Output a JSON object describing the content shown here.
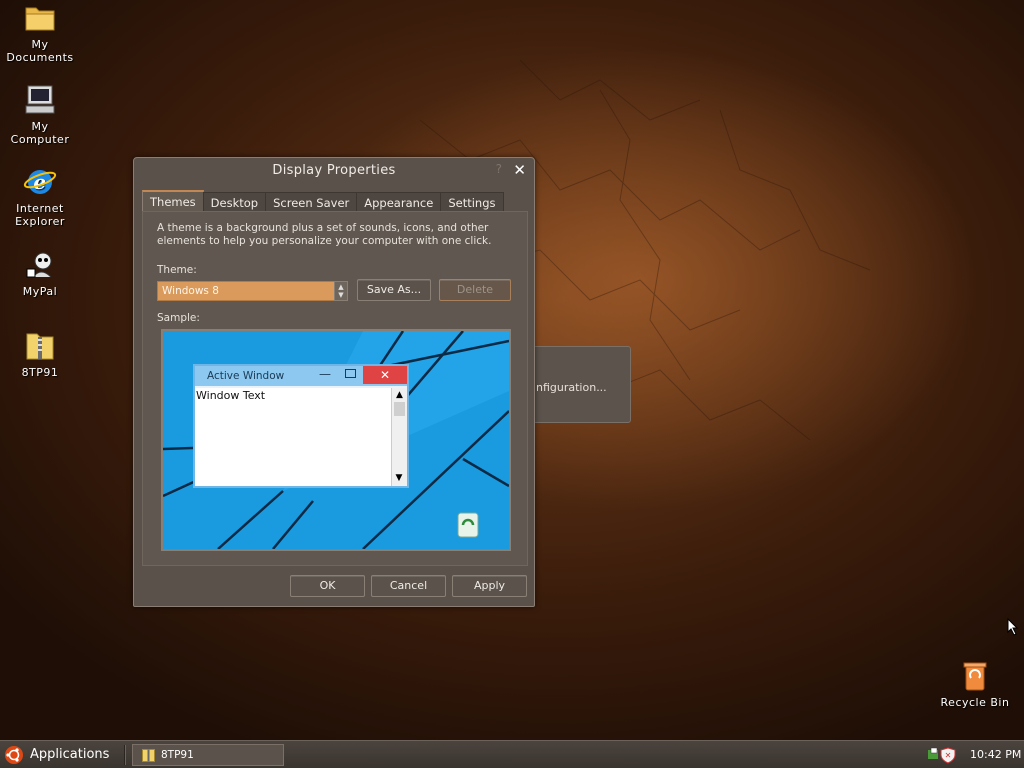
{
  "desktop": {
    "icons": [
      {
        "label_line1": "My",
        "label_line2": "Documents",
        "icon": "folder-icon"
      },
      {
        "label_line1": "My",
        "label_line2": "Computer",
        "icon": "computer-icon"
      },
      {
        "label_line1": "Internet",
        "label_line2": "Explorer",
        "icon": "internet-explorer-icon"
      },
      {
        "label_line1": "MyPal",
        "label_line2": "",
        "icon": "mypal-icon"
      },
      {
        "label_line1": "8TP91",
        "label_line2": "",
        "icon": "zip-folder-icon"
      },
      {
        "label_line1": "Recycle Bin",
        "label_line2": "",
        "icon": "recycle-bin-icon"
      }
    ],
    "background_dialog_text": "nfiguration..."
  },
  "dialog": {
    "title": "Display Properties",
    "help": "?",
    "close": "✕",
    "tabs": [
      "Themes",
      "Desktop",
      "Screen Saver",
      "Appearance",
      "Settings"
    ],
    "active_tab": "Themes",
    "description": "A theme is a background plus a set of sounds, icons, and other elements to help you personalize your computer with one click.",
    "theme_label": "Theme:",
    "theme_value": "Windows 8",
    "save_as": "Save As...",
    "delete": "Delete",
    "sample_label": "Sample:",
    "sample": {
      "window_title": "Active Window",
      "window_text": "Window Text"
    },
    "ok": "OK",
    "cancel": "Cancel",
    "apply": "Apply"
  },
  "taskbar": {
    "start_label": "Applications",
    "task_label": "8TP91",
    "clock": "10:42 PM"
  },
  "colors": {
    "accent": "#d99a5c",
    "sample_bg": "#1a9be0",
    "close_red": "#e04343"
  }
}
